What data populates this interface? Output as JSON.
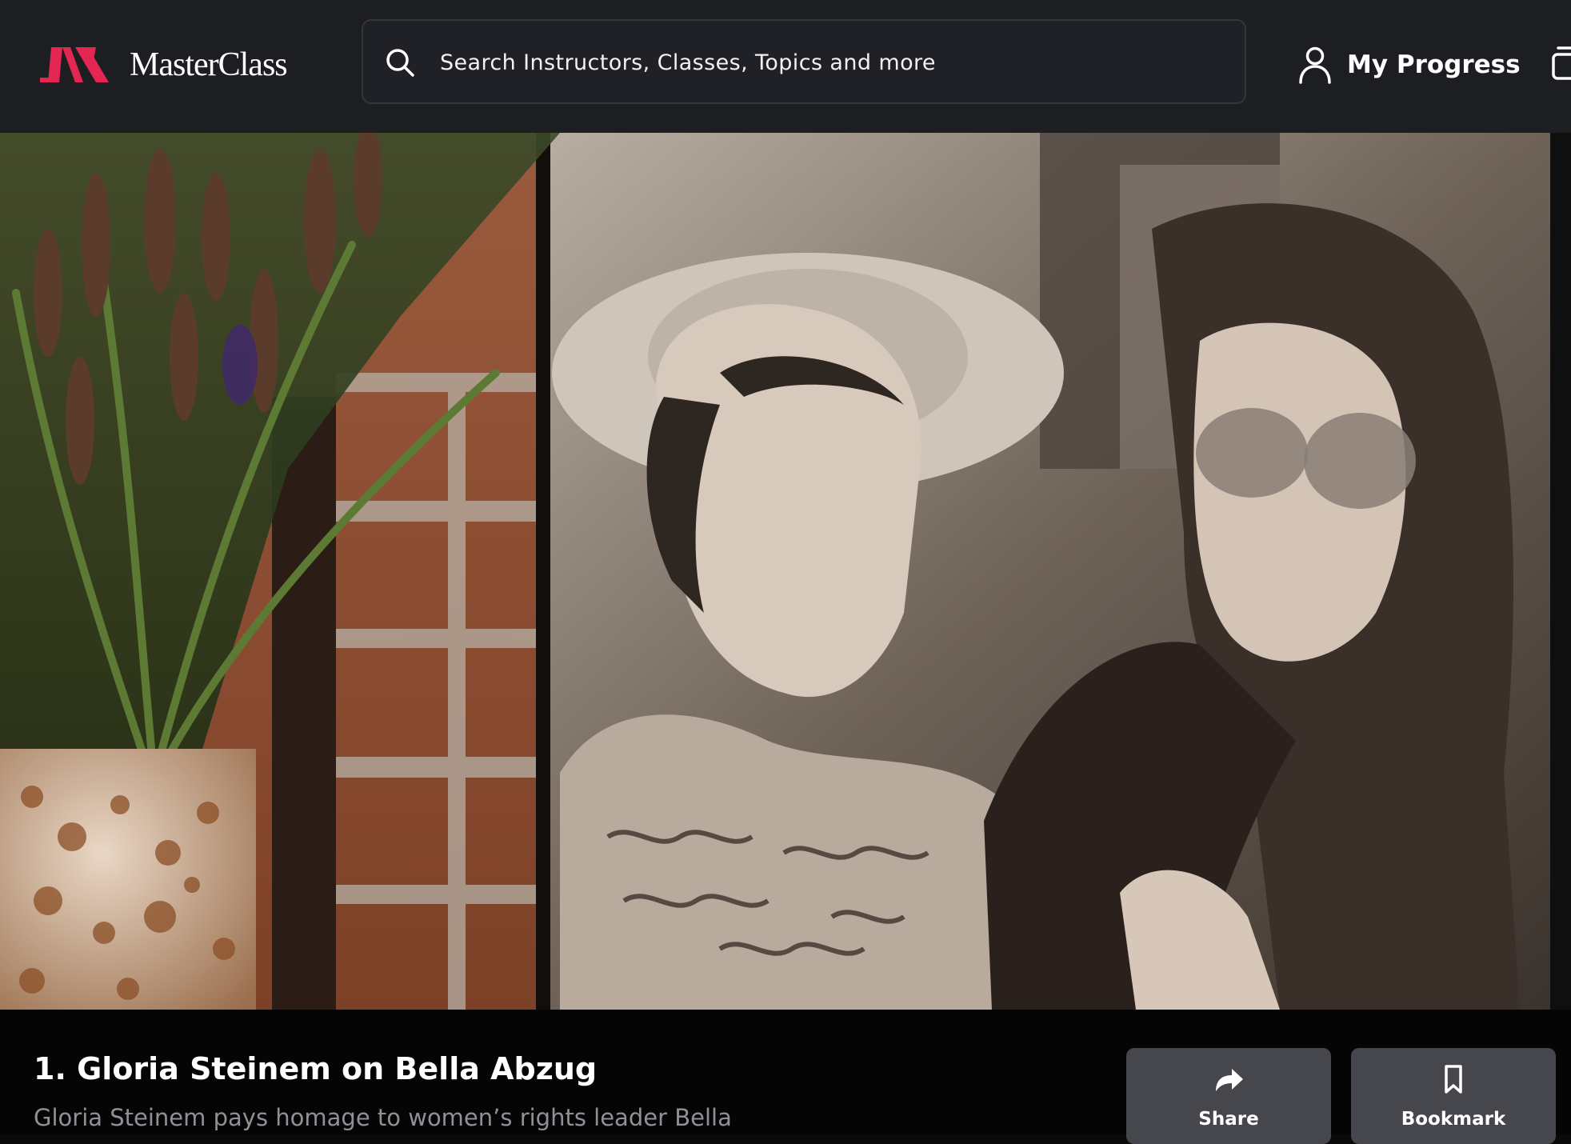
{
  "header": {
    "brand": "MasterClass",
    "search": {
      "placeholder": "Search Instructors, Classes, Topics and more",
      "value": "",
      "icon": "search-icon"
    },
    "progress": {
      "label": "My Progress",
      "icon": "person-icon"
    },
    "library_icon": "library-icon"
  },
  "video": {
    "content": "video-frame"
  },
  "lesson": {
    "title": "1. Gloria Steinem on Bella Abzug",
    "description": "Gloria Steinem pays homage to women’s rights leader Bella",
    "actions": {
      "share": {
        "label": "Share",
        "icon": "share-icon"
      },
      "bookmark": {
        "label": "Bookmark",
        "icon": "bookmark-icon"
      }
    }
  },
  "colors": {
    "brand_accent": "#e32652",
    "header_bg": "#1d1e22",
    "button_bg": "#46474c",
    "muted_text": "#8f9196"
  }
}
